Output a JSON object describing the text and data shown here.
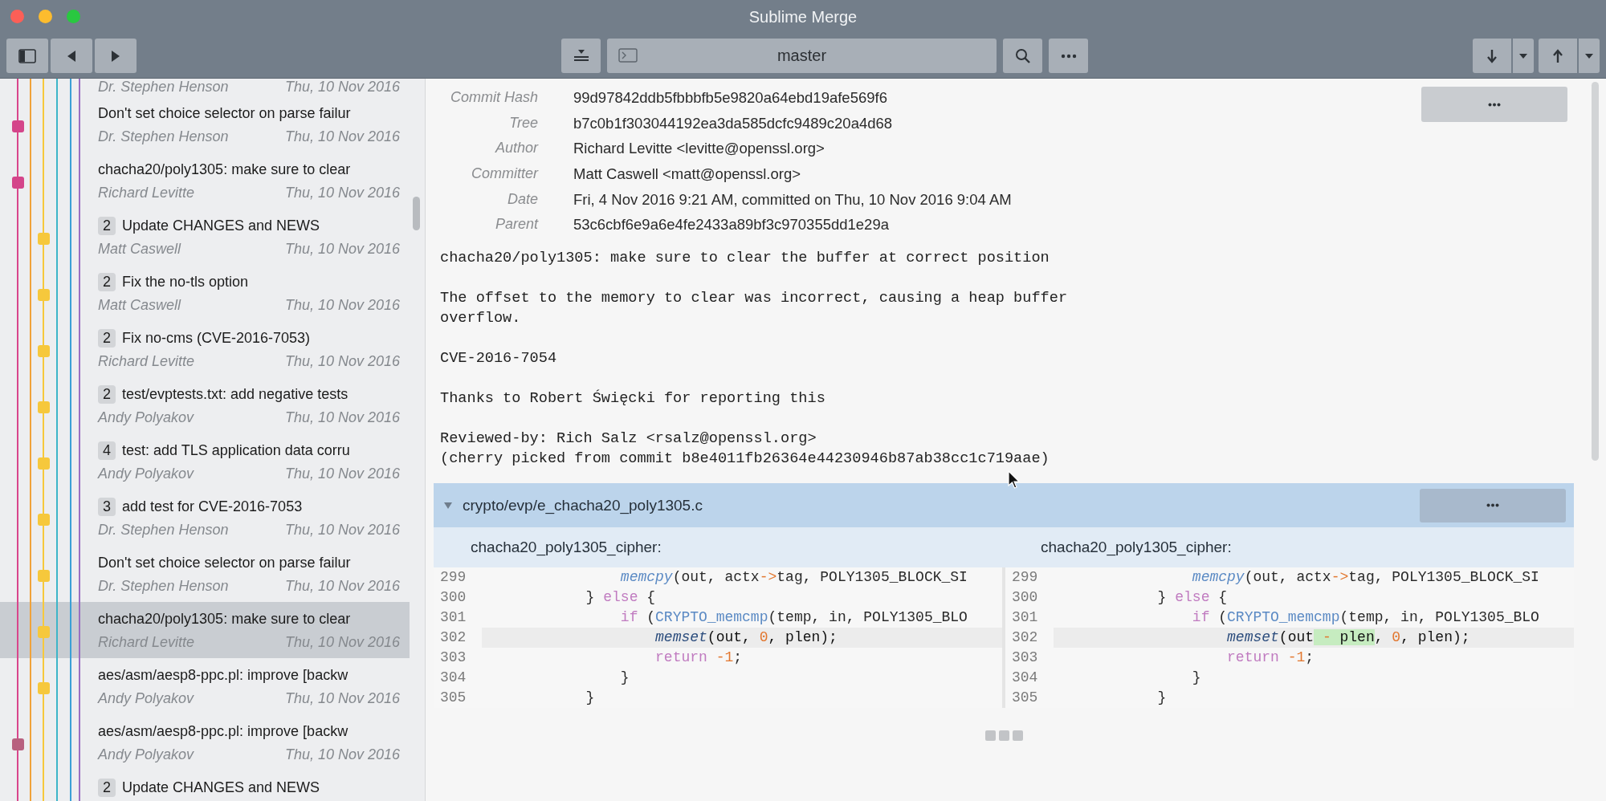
{
  "window": {
    "title": "Sublime Merge"
  },
  "toolbar": {
    "branch": "master"
  },
  "commits": [
    {
      "author": "Dr. Stephen Henson",
      "date": "Thu, 10 Nov 2016",
      "selected": false,
      "kind": "none"
    },
    {
      "subject": "Don't set choice selector on parse failur",
      "author": "Dr. Stephen Henson",
      "date": "Thu, 10 Nov 2016",
      "selected": false,
      "kind": "feature",
      "color": "#d4458a"
    },
    {
      "subject": "chacha20/poly1305: make sure to clear",
      "author": "Richard Levitte",
      "date": "Thu, 10 Nov 2016",
      "selected": false,
      "kind": "feature",
      "color": "#d4458a"
    },
    {
      "badge": "2",
      "subject": "Update CHANGES and NEWS",
      "author": "Matt Caswell",
      "date": "Thu, 10 Nov 2016",
      "selected": false,
      "kind": "mainline",
      "color": "#f6c83c"
    },
    {
      "badge": "2",
      "subject": "Fix the no-tls option",
      "author": "Matt Caswell",
      "date": "Thu, 10 Nov 2016",
      "selected": false,
      "kind": "mainline",
      "color": "#f6c83c"
    },
    {
      "badge": "2",
      "subject": "Fix no-cms (CVE-2016-7053)",
      "author": "Richard Levitte",
      "date": "Thu, 10 Nov 2016",
      "selected": false,
      "kind": "mainline",
      "color": "#f6c83c"
    },
    {
      "badge": "2",
      "subject": "test/evptests.txt: add negative tests",
      "author": "Andy Polyakov",
      "date": "Thu, 10 Nov 2016",
      "selected": false,
      "kind": "mainline",
      "color": "#f6c83c"
    },
    {
      "badge": "4",
      "subject": "test: add TLS application data corru",
      "author": "Andy Polyakov",
      "date": "Thu, 10 Nov 2016",
      "selected": false,
      "kind": "mainline",
      "color": "#f6c83c"
    },
    {
      "badge": "3",
      "subject": "add test for CVE-2016-7053",
      "author": "Dr. Stephen Henson",
      "date": "Thu, 10 Nov 2016",
      "selected": false,
      "kind": "mainline",
      "color": "#f6c83c"
    },
    {
      "subject": "Don't set choice selector on parse failur",
      "author": "Dr. Stephen Henson",
      "date": "Thu, 10 Nov 2016",
      "selected": false,
      "kind": "mainline",
      "color": "#f6c83c"
    },
    {
      "subject": "chacha20/poly1305: make sure to clear",
      "author": "Richard Levitte",
      "date": "Thu, 10 Nov 2016",
      "selected": true,
      "kind": "mainline",
      "color": "#f6c83c"
    },
    {
      "subject": "aes/asm/aesp8-ppc.pl: improve [backw",
      "author": "Andy Polyakov",
      "date": "Thu, 10 Nov 2016",
      "selected": false,
      "kind": "mainline",
      "color": "#f6c83c"
    },
    {
      "subject": "aes/asm/aesp8-ppc.pl: improve [backw",
      "author": "Andy Polyakov",
      "date": "Thu, 10 Nov 2016",
      "selected": false,
      "kind": "feature",
      "color": "#b8607f"
    },
    {
      "badge": "2",
      "subject": "Update CHANGES and NEWS",
      "selected": false,
      "kind": "none"
    }
  ],
  "details": {
    "fields": [
      {
        "label": "Commit Hash",
        "value": "99d97842ddb5fbbbfb5e9820a64ebd19afe569f6"
      },
      {
        "label": "Tree",
        "value": "b7c0b1f303044192ea3da585dcfc9489c20a4d68"
      },
      {
        "label": "Author",
        "value": "Richard Levitte <levitte@openssl.org>"
      },
      {
        "label": "Committer",
        "value": "Matt Caswell <matt@openssl.org>"
      },
      {
        "label": "Date",
        "value": "Fri, 4 Nov 2016 9:21 AM, committed on Thu, 10 Nov 2016 9:04 AM"
      },
      {
        "label": "Parent",
        "value": "53c6cbf6e9a6e4fe2433a89bf3c970355dd1e29a"
      }
    ],
    "message": [
      "chacha20/poly1305: make sure to clear the buffer at correct position",
      "The offset to the memory to clear was incorrect, causing a heap buffer\noverflow.",
      "CVE-2016-7054",
      "Thanks to Robert Święcki for reporting this",
      "Reviewed-by: Rich Salz <rsalz@openssl.org>\n(cherry picked from commit b8e4011fb26364e44230946b87ab38cc1c719aae)"
    ]
  },
  "file": {
    "path": "crypto/evp/e_chacha20_poly1305.c",
    "expanded": true,
    "hunk": {
      "titles": [
        "chacha20_poly1305_cipher:",
        "chacha20_poly1305_cipher:"
      ],
      "panes": [
        [
          {
            "number": "299",
            "changed": false,
            "tokens": [
              {
                "text": "                memcpy",
                "kind": "function"
              },
              {
                "text": "(out, actx"
              },
              {
                "text": "->",
                "kind": "operator"
              },
              {
                "text": "tag, POLY1305_BLOCK_SI"
              }
            ]
          },
          {
            "number": "300",
            "changed": false,
            "tokens": [
              {
                "text": "            } "
              },
              {
                "text": "else",
                "kind": "keyword"
              },
              {
                "text": " {"
              }
            ]
          },
          {
            "number": "301",
            "changed": false,
            "tokens": [
              {
                "text": "                if",
                "kind": "keyword"
              },
              {
                "text": " ("
              },
              {
                "text": "CRYPTO_memcmp",
                "kind": "builtin"
              },
              {
                "text": "(temp, in, POLY1305_BLO"
              }
            ]
          },
          {
            "number": "302",
            "changed": true,
            "tokens": [
              {
                "text": "                    memset",
                "kind": "function"
              },
              {
                "text": "(out, "
              },
              {
                "text": "0",
                "kind": "number"
              },
              {
                "text": ", plen);"
              }
            ]
          },
          {
            "number": "303",
            "changed": false,
            "tokens": [
              {
                "text": "                    return",
                "kind": "keyword"
              },
              {
                "text": " -1",
                "kind": "number"
              },
              {
                "text": ";"
              }
            ]
          },
          {
            "number": "304",
            "changed": false,
            "tokens": [
              {
                "text": "                }"
              }
            ]
          },
          {
            "number": "305",
            "changed": false,
            "tokens": [
              {
                "text": "            }"
              }
            ]
          }
        ],
        [
          {
            "number": "299",
            "changed": false,
            "tokens": [
              {
                "text": "                memcpy",
                "kind": "function"
              },
              {
                "text": "(out, actx"
              },
              {
                "text": "->",
                "kind": "operator"
              },
              {
                "text": "tag, POLY1305_BLOCK_SI"
              }
            ]
          },
          {
            "number": "300",
            "changed": false,
            "tokens": [
              {
                "text": "            } "
              },
              {
                "text": "else",
                "kind": "keyword"
              },
              {
                "text": " {"
              }
            ]
          },
          {
            "number": "301",
            "changed": false,
            "tokens": [
              {
                "text": "                if",
                "kind": "keyword"
              },
              {
                "text": " ("
              },
              {
                "text": "CRYPTO_memcmp",
                "kind": "builtin"
              },
              {
                "text": "(temp, in, POLY1305_BLO"
              }
            ]
          },
          {
            "number": "302",
            "changed": true,
            "tokens": [
              {
                "text": "                    memset",
                "kind": "function"
              },
              {
                "text": "(out"
              },
              {
                "text": " -",
                "kind": "operator",
                "inserted": true
              },
              {
                "text": " plen",
                "inserted": true
              },
              {
                "text": ", "
              },
              {
                "text": "0",
                "kind": "number"
              },
              {
                "text": ", plen);"
              }
            ]
          },
          {
            "number": "303",
            "changed": false,
            "tokens": [
              {
                "text": "                    return",
                "kind": "keyword"
              },
              {
                "text": " -1",
                "kind": "number"
              },
              {
                "text": ";"
              }
            ]
          },
          {
            "number": "304",
            "changed": false,
            "tokens": [
              {
                "text": "                }"
              }
            ]
          },
          {
            "number": "305",
            "changed": false,
            "tokens": [
              {
                "text": "            }"
              }
            ]
          }
        ]
      ]
    }
  }
}
